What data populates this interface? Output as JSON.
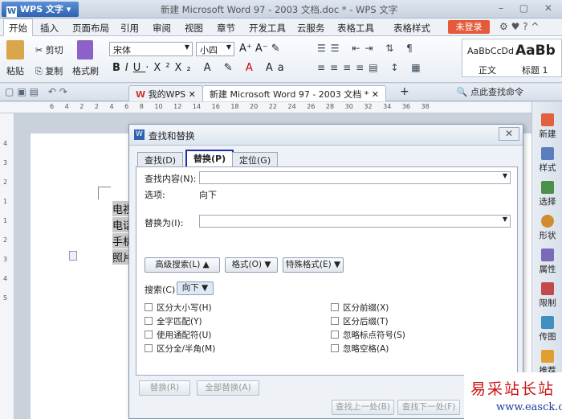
{
  "app": {
    "name": "WPS 文字",
    "doc_title": "新建 Microsoft Word 97 - 2003 文档.doc * - WPS 文字"
  },
  "menu": [
    "开始",
    "插入",
    "页面布局",
    "引用",
    "审阅",
    "视图",
    "章节",
    "开发工具",
    "云服务",
    "表格工具",
    "表格样式"
  ],
  "login": "未登录",
  "ribbon": {
    "cut": "剪切",
    "paste": "粘贴",
    "copy": "复制",
    "format_painter": "格式刷",
    "font": "宋体",
    "size": "小四",
    "styles": [
      "AaBbCcDd",
      "AaBb"
    ],
    "style_names": [
      "正文",
      "标题 1"
    ]
  },
  "tabs": [
    "我的WPS",
    "新建 Microsoft Word 97 - 2003 文档 *"
  ],
  "find_cmd": "点此查找命令",
  "ruler_ticks": [
    "6",
    "4",
    "2",
    "2",
    "4",
    "6",
    "8",
    "10",
    "12",
    "14",
    "16",
    "18",
    "20",
    "22",
    "24",
    "26",
    "28",
    "30",
    "32",
    "34",
    "36",
    "38"
  ],
  "vruler_ticks": [
    "4",
    "3",
    "2",
    "1",
    "1",
    "2",
    "3",
    "4",
    "5"
  ],
  "doc_lines": [
    "电视",
    "电话",
    "手机",
    "照片"
  ],
  "right_panel": [
    "新建",
    "样式",
    "选择",
    "形状",
    "属性",
    "限制",
    "传图",
    "推荐"
  ],
  "dialog": {
    "title": "查找和替换",
    "tabs": [
      "查找(D)",
      "替换(P)",
      "定位(G)"
    ],
    "find_label": "查找内容(N):",
    "options_label": "选项:",
    "options_value": "向下",
    "replace_label": "替换为(I):",
    "btn_advanced": "高级搜索(L) ▲",
    "btn_format": "格式(O) ▼",
    "btn_special": "特殊格式(E) ▼",
    "search_label": "搜索(C)",
    "search_value": "向下",
    "checks_left": [
      "区分大小写(H)",
      "全字匹配(Y)",
      "使用通配符(U)",
      "区分全/半角(M)"
    ],
    "checks_right": [
      "区分前缀(X)",
      "区分后缀(T)",
      "忽略标点符号(S)",
      "忽略空格(A)"
    ],
    "btn_replace": "替换(R)",
    "btn_replace_all": "全部替换(A)",
    "btn_prev": "查找上一处(B)",
    "btn_next": "查找下一处(F)"
  },
  "watermark": {
    "line1": "易采站长站",
    "line2": "www.easck.com"
  }
}
